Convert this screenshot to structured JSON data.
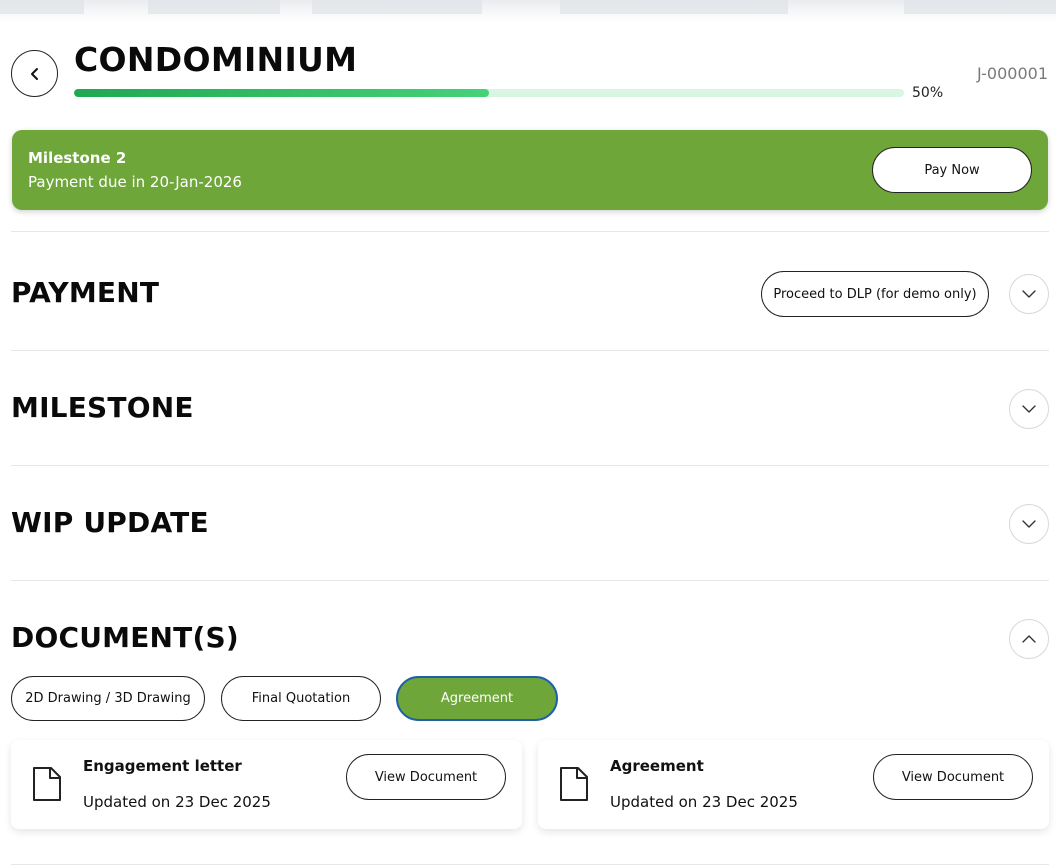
{
  "header": {
    "title": "CONDOMINIUM",
    "progress_percent": 50,
    "progress_label": "50%",
    "job_id": "J-000001"
  },
  "banner": {
    "title": "Milestone 2",
    "subtitle": "Payment due in 20-Jan-2026",
    "pay_label": "Pay Now"
  },
  "sections": {
    "payment": {
      "title": "PAYMENT",
      "action_label": "Proceed to DLP (for demo only)"
    },
    "milestone": {
      "title": "MILESTONE"
    },
    "wip": {
      "title": "WIP UPDATE"
    },
    "documents": {
      "title": "DOCUMENT(S)"
    }
  },
  "document_tabs": [
    {
      "label": "2D Drawing / 3D Drawing",
      "active": false
    },
    {
      "label": "Final Quotation",
      "active": false
    },
    {
      "label": "Agreement",
      "active": true
    }
  ],
  "document_cards": [
    {
      "name": "Engagement letter",
      "updated": "Updated on 23 Dec 2025",
      "button": "View Document"
    },
    {
      "name": "Agreement",
      "updated": "Updated on 23 Dec 2025",
      "button": "View Document"
    }
  ],
  "colors": {
    "accent_green": "#6ea63a",
    "progress_green": "#1fa851",
    "active_tab_border": "#1f5fa8"
  },
  "icons": {
    "back": "chevron-left-icon",
    "expand": "chevron-down-icon",
    "collapse": "chevron-up-icon",
    "document": "document-icon"
  }
}
